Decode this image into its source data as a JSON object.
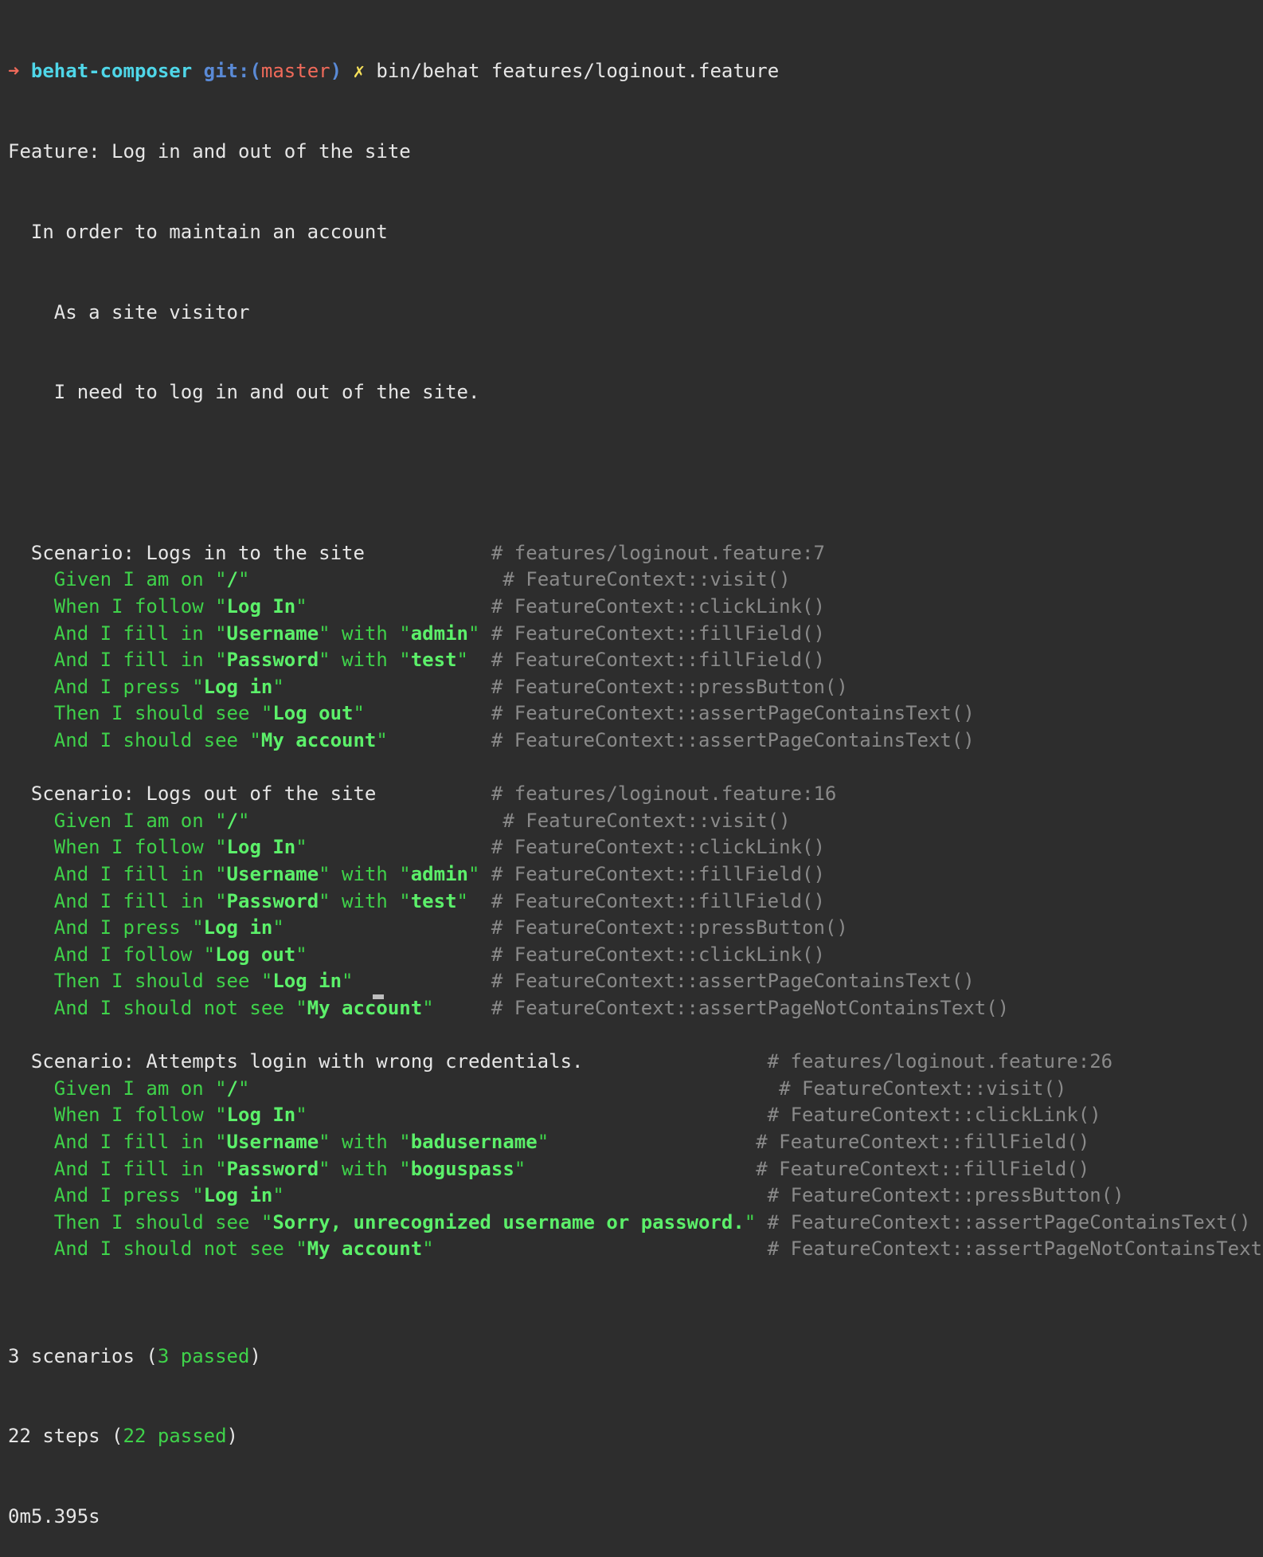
{
  "prompt": {
    "arrow": "➜",
    "repo": "behat-composer",
    "git_label": "git:(",
    "branch": "master",
    "git_close": ")",
    "dirty_mark": "✗",
    "command": "bin/behat features/loginout.feature"
  },
  "feature": {
    "title": "Feature: Log in and out of the site",
    "lines": [
      "  In order to maintain an account",
      "    As a site visitor",
      "    I need to log in and out of the site."
    ]
  },
  "scenario1": {
    "title": "  Scenario: Logs in to the site           ",
    "comment": "# features/loginout.feature:7",
    "steps": [
      {
        "s1": "    Given I am on \"",
        "a1": "/",
        "s2": "\"",
        "a2": "",
        "s3": "",
        "pad": "                      ",
        "comment": "# FeatureContext::visit()"
      },
      {
        "s1": "    When I follow \"",
        "a1": "Log In",
        "s2": "\"",
        "a2": "",
        "s3": "",
        "pad": "                ",
        "comment": "# FeatureContext::clickLink()"
      },
      {
        "s1": "    And I fill in \"",
        "a1": "Username",
        "s2": "\" with \"",
        "a2": "admin",
        "s3": "\"",
        "pad": " ",
        "comment": "# FeatureContext::fillField()"
      },
      {
        "s1": "    And I fill in \"",
        "a1": "Password",
        "s2": "\" with \"",
        "a2": "test",
        "s3": "\"",
        "pad": "  ",
        "comment": "# FeatureContext::fillField()"
      },
      {
        "s1": "    And I press \"",
        "a1": "Log in",
        "s2": "\"",
        "a2": "",
        "s3": "",
        "pad": "                  ",
        "comment": "# FeatureContext::pressButton()"
      },
      {
        "s1": "    Then I should see \"",
        "a1": "Log out",
        "s2": "\"",
        "a2": "",
        "s3": "",
        "pad": "           ",
        "comment": "# FeatureContext::assertPageContainsText()"
      },
      {
        "s1": "    And I should see \"",
        "a1": "My account",
        "s2": "\"",
        "a2": "",
        "s3": "",
        "pad": "         ",
        "comment": "# FeatureContext::assertPageContainsText()"
      }
    ]
  },
  "scenario2": {
    "title": "  Scenario: Logs out of the site          ",
    "comment": "# features/loginout.feature:16",
    "steps": [
      {
        "s1": "    Given I am on \"",
        "a1": "/",
        "s2": "\"",
        "a2": "",
        "s3": "",
        "pad": "                      ",
        "comment": "# FeatureContext::visit()"
      },
      {
        "s1": "    When I follow \"",
        "a1": "Log In",
        "s2": "\"",
        "a2": "",
        "s3": "",
        "pad": "                ",
        "comment": "# FeatureContext::clickLink()"
      },
      {
        "s1": "    And I fill in \"",
        "a1": "Username",
        "s2": "\" with \"",
        "a2": "admin",
        "s3": "\"",
        "pad": " ",
        "comment": "# FeatureContext::fillField()"
      },
      {
        "s1": "    And I fill in \"",
        "a1": "Password",
        "s2": "\" with \"",
        "a2": "test",
        "s3": "\"",
        "pad": "  ",
        "comment": "# FeatureContext::fillField()"
      },
      {
        "s1": "    And I press \"",
        "a1": "Log in",
        "s2": "\"",
        "a2": "",
        "s3": "",
        "pad": "                  ",
        "comment": "# FeatureContext::pressButton()"
      },
      {
        "s1": "    And I follow \"",
        "a1": "Log out",
        "s2": "\"",
        "a2": "",
        "s3": "",
        "pad": "                ",
        "comment": "# FeatureContext::clickLink()"
      },
      {
        "s1": "    Then I should see \"",
        "a1": "Log in",
        "s2": "\"",
        "a2": "",
        "s3": "",
        "pad": "            ",
        "comment": "# FeatureContext::assertPageContainsText()"
      },
      {
        "s1": "    And I should not see \"",
        "a1": "My account",
        "s2": "\"",
        "a2": "",
        "s3": "",
        "pad": "     ",
        "comment": "# FeatureContext::assertPageNotContainsText()"
      }
    ]
  },
  "scenario3": {
    "title": "  Scenario: Attempts login with wrong credentials.                ",
    "comment": "# features/loginout.feature:26",
    "steps": [
      {
        "s1": "    Given I am on \"",
        "a1": "/",
        "s2": "\"",
        "a2": "",
        "s3": "",
        "pad": "                                              ",
        "comment": "# FeatureContext::visit()"
      },
      {
        "s1": "    When I follow \"",
        "a1": "Log In",
        "s2": "\"",
        "a2": "",
        "s3": "",
        "pad": "                                        ",
        "comment": "# FeatureContext::clickLink()"
      },
      {
        "s1": "    And I fill in \"",
        "a1": "Username",
        "s2": "\" with \"",
        "a2": "badusername",
        "s3": "\"",
        "pad": "                  ",
        "comment": "# FeatureContext::fillField()"
      },
      {
        "s1": "    And I fill in \"",
        "a1": "Password",
        "s2": "\" with \"",
        "a2": "boguspass",
        "s3": "\"",
        "pad": "                    ",
        "comment": "# FeatureContext::fillField()"
      },
      {
        "s1": "    And I press \"",
        "a1": "Log in",
        "s2": "\"",
        "a2": "",
        "s3": "",
        "pad": "                                          ",
        "comment": "# FeatureContext::pressButton()"
      },
      {
        "s1": "    Then I should see \"",
        "a1": "Sorry, unrecognized username or password.",
        "s2": "\"",
        "a2": "",
        "s3": "",
        "pad": " ",
        "comment": "# FeatureContext::assertPageContainsText()"
      },
      {
        "s1": "    And I should not see \"",
        "a1": "My account",
        "s2": "\"",
        "a2": "",
        "s3": "",
        "pad": "                             ",
        "comment": "# FeatureContext::assertPageNotContainsText()"
      }
    ]
  },
  "summary": {
    "scenarios_prefix": "3 scenarios (",
    "scenarios_passed": "3 passed",
    "scenarios_suffix": ")",
    "steps_prefix": "22 steps (",
    "steps_passed": "22 passed",
    "steps_suffix": ")",
    "time": "0m5.395s"
  },
  "colors": {
    "background": "#2d2d2d",
    "text": "#e6e6e6",
    "step_green": "#3fd24a",
    "arg_green": "#5cf06a",
    "comment_gray": "#8a8a8a",
    "prompt_arrow": "#f06a5a",
    "repo_cyan": "#4fd6e8",
    "git_blue": "#5a8ad6",
    "dirty_yellow": "#f7e15a"
  }
}
